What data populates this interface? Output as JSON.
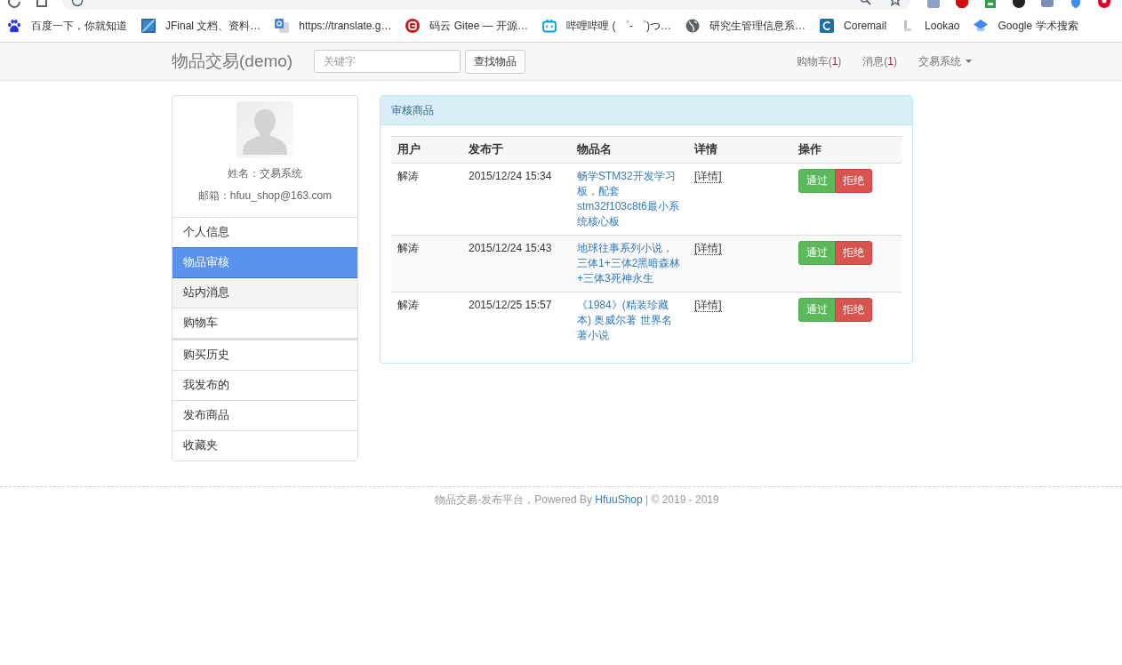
{
  "browser": {
    "bookmarks": [
      {
        "label": "百度一下，你就知道",
        "kind": "paw"
      },
      {
        "label": "JFinal 文档、资料…",
        "kind": "tile"
      },
      {
        "label": "https://translate.g…",
        "kind": "translate"
      },
      {
        "label": "码云 Gitee — 开源…",
        "kind": "ring"
      },
      {
        "label": "哔哩哔哩 ( ゜- ゜)つ…",
        "kind": "tv"
      },
      {
        "label": "研究生管理信息系…",
        "kind": "globe"
      },
      {
        "label": "Coremail",
        "kind": "arc"
      },
      {
        "label": "Lookao",
        "kind": "corner"
      },
      {
        "label": "Google 学术搜索",
        "kind": "cap"
      }
    ]
  },
  "navbar": {
    "brand": "物品交易(demo)",
    "search": {
      "placeholder": "关键字"
    },
    "search_button": "查找物品",
    "links": [
      {
        "kind": "counter",
        "label": "购物车(",
        "count": "1",
        "suffix": ")"
      },
      {
        "kind": "counter",
        "label": "消息(",
        "count": "1",
        "suffix": ")"
      },
      {
        "kind": "dropdown",
        "label": "交易系统"
      }
    ]
  },
  "profile": {
    "name": "姓名：交易系统",
    "email": "邮箱：hfuu_shop@163.com"
  },
  "menu_groups": [
    {
      "items": [
        {
          "label": "个人信息",
          "selected": false,
          "hovered": false
        },
        {
          "label": "物品审核",
          "selected": true,
          "hovered": false
        },
        {
          "label": "站内消息",
          "selected": false,
          "hovered": true
        },
        {
          "label": "购物车",
          "selected": false,
          "hovered": false
        }
      ]
    },
    {
      "items": [
        {
          "label": "购买历史",
          "selected": false,
          "hovered": false
        },
        {
          "label": "我发布的",
          "selected": false,
          "hovered": false
        },
        {
          "label": "发布商品",
          "selected": false,
          "hovered": false
        },
        {
          "label": "收藏夹",
          "selected": false,
          "hovered": false
        }
      ]
    }
  ],
  "panel": {
    "title": "审核商品",
    "table": {
      "columns": [
        "用户",
        "发布于",
        "物品名",
        "详情",
        "操作"
      ],
      "rows": [
        {
          "user": "解涛",
          "published": "2015/12/24 15:34",
          "item": "畅学STM32开发学习板，配套stm32f103c8t6最小系统核心板",
          "details": "[详情]",
          "actions": [
            {
              "label": "通过",
              "kind": "approve"
            },
            {
              "label": "拒绝",
              "kind": "reject"
            }
          ]
        },
        {
          "user": "解涛",
          "published": "2015/12/24 15:43",
          "item": "地球往事系列小说，三体1+三体2黑暗森林+三体3死神永生",
          "details": "[详情]",
          "actions": [
            {
              "label": "通过",
              "kind": "approve"
            },
            {
              "label": "拒绝",
              "kind": "reject"
            }
          ]
        },
        {
          "user": "解涛",
          "published": "2015/12/25 15:57",
          "item": "《1984》(精装珍藏本) 奥威尔著 世界名著小说",
          "details": "[详情]",
          "actions": [
            {
              "label": "通过",
              "kind": "approve"
            },
            {
              "label": "拒绝",
              "kind": "reject"
            }
          ]
        }
      ]
    }
  },
  "footer": {
    "text_before": "物品交易-发布平台，Powered By ",
    "link": "HfuuShop",
    "text_after": " | © 2019 - 2019"
  }
}
